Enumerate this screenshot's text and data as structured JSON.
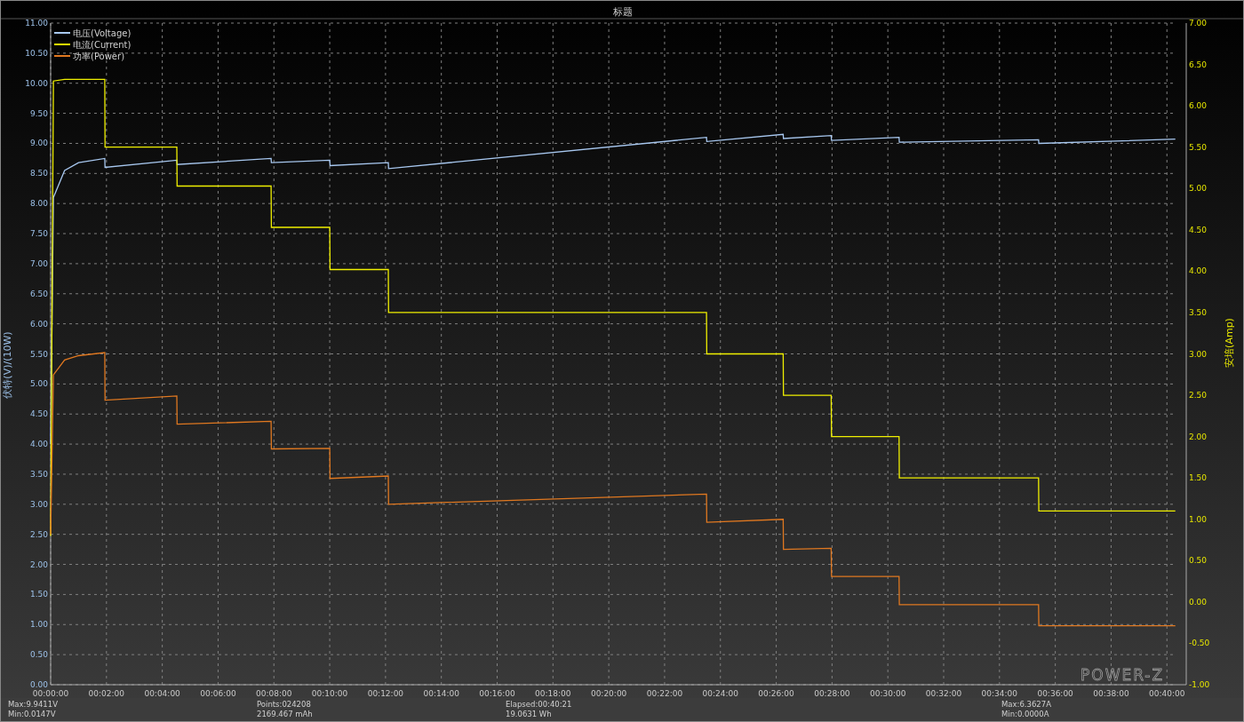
{
  "chart_data": {
    "type": "line",
    "title": "标题",
    "grid": true,
    "legend": "upper left",
    "ylabel": "伏特(V)/(10W)",
    "xlim": [
      0,
      40.31
    ],
    "ylim": [
      0,
      11
    ],
    "y2label": "安培(Amp)",
    "y2lim": [
      -1,
      7
    ],
    "x": [
      0,
      0.1,
      0.5,
      1,
      1.94,
      1.95,
      4.52,
      4.53,
      7.9,
      7.91,
      10.0,
      10.01,
      12.1,
      12.11,
      23.5,
      23.51,
      26.25,
      26.26,
      27.97,
      27.98,
      30.4,
      30.41,
      35.4,
      35.41,
      40.3
    ],
    "series": [
      {
        "name": "电压(Voltage)",
        "color": "#a8c8f0",
        "values": [
          4.0,
          8.1,
          8.55,
          8.68,
          8.75,
          8.6,
          8.72,
          8.65,
          8.75,
          8.68,
          8.72,
          8.63,
          8.68,
          8.58,
          9.1,
          9.03,
          9.15,
          9.08,
          9.13,
          9.05,
          9.1,
          9.02,
          9.06,
          9.0,
          9.07
        ]
      },
      {
        "name": "电流(Current)",
        "color": "#f0f000",
        "axis": "y2",
        "values": [
          0.8,
          6.3,
          6.32,
          6.32,
          6.32,
          5.5,
          5.5,
          5.03,
          5.03,
          4.53,
          4.53,
          4.02,
          4.02,
          3.5,
          3.5,
          3.0,
          3.0,
          2.5,
          2.5,
          2.0,
          2.0,
          1.5,
          1.5,
          1.1,
          1.1
        ]
      },
      {
        "name": "功率(Power)",
        "color": "#e07820",
        "values": [
          2.5,
          5.15,
          5.4,
          5.47,
          5.52,
          4.73,
          4.8,
          4.33,
          4.38,
          3.92,
          3.93,
          3.43,
          3.47,
          3.0,
          3.17,
          2.7,
          2.75,
          2.25,
          2.27,
          1.8,
          1.8,
          1.33,
          1.33,
          0.98,
          0.98
        ]
      }
    ],
    "xticks": [
      {
        "value": 0,
        "label": "00:00:00"
      },
      {
        "value": 2,
        "label": "00:02:00"
      },
      {
        "value": 4,
        "label": "00:04:00"
      },
      {
        "value": 6,
        "label": "00:06:00"
      },
      {
        "value": 8,
        "label": "00:08:00"
      },
      {
        "value": 10,
        "label": "00:10:00"
      },
      {
        "value": 12,
        "label": "00:12:00"
      },
      {
        "value": 14,
        "label": "00:14:00"
      },
      {
        "value": 16,
        "label": "00:16:00"
      },
      {
        "value": 18,
        "label": "00:18:00"
      },
      {
        "value": 20,
        "label": "00:20:00"
      },
      {
        "value": 22,
        "label": "00:22:00"
      },
      {
        "value": 24,
        "label": "00:24:00"
      },
      {
        "value": 26,
        "label": "00:26:00"
      },
      {
        "value": 28,
        "label": "00:28:00"
      },
      {
        "value": 30,
        "label": "00:30:00"
      },
      {
        "value": 32,
        "label": "00:32:00"
      },
      {
        "value": 34,
        "label": "00:34:00"
      },
      {
        "value": 36,
        "label": "00:36:00"
      },
      {
        "value": 38,
        "label": "00:38:00"
      },
      {
        "value": 40,
        "label": "00:40:00"
      }
    ],
    "yticks": [
      {
        "value": 0,
        "label": "0.00"
      },
      {
        "value": 0.5,
        "label": "0.50"
      },
      {
        "value": 1,
        "label": "1.00"
      },
      {
        "value": 1.5,
        "label": "1.50"
      },
      {
        "value": 2,
        "label": "2.00"
      },
      {
        "value": 2.5,
        "label": "2.50"
      },
      {
        "value": 3,
        "label": "3.00"
      },
      {
        "value": 3.5,
        "label": "3.50"
      },
      {
        "value": 4,
        "label": "4.00"
      },
      {
        "value": 4.5,
        "label": "4.50"
      },
      {
        "value": 5,
        "label": "5.00"
      },
      {
        "value": 5.5,
        "label": "5.50"
      },
      {
        "value": 6,
        "label": "6.00"
      },
      {
        "value": 6.5,
        "label": "6.50"
      },
      {
        "value": 7,
        "label": "7.00"
      },
      {
        "value": 7.5,
        "label": "7.50"
      },
      {
        "value": 8,
        "label": "8.00"
      },
      {
        "value": 8.5,
        "label": "8.50"
      },
      {
        "value": 9,
        "label": "9.00"
      },
      {
        "value": 9.5,
        "label": "9.50"
      },
      {
        "value": 10,
        "label": "10.00"
      },
      {
        "value": 10.5,
        "label": "10.50"
      },
      {
        "value": 11,
        "label": "11.00"
      }
    ],
    "y2ticks": [
      {
        "value": -1,
        "label": "-1.00"
      },
      {
        "value": -0.5,
        "label": "-0.50"
      },
      {
        "value": 0,
        "label": "0.00"
      },
      {
        "value": 0.5,
        "label": "0.50"
      },
      {
        "value": 1,
        "label": "1.00"
      },
      {
        "value": 1.5,
        "label": "1.50"
      },
      {
        "value": 2,
        "label": "2.00"
      },
      {
        "value": 2.5,
        "label": "2.50"
      },
      {
        "value": 3,
        "label": "3.00"
      },
      {
        "value": 3.5,
        "label": "3.50"
      },
      {
        "value": 4,
        "label": "4.00"
      },
      {
        "value": 4.5,
        "label": "4.50"
      },
      {
        "value": 5,
        "label": "5.00"
      },
      {
        "value": 5.5,
        "label": "5.50"
      },
      {
        "value": 6,
        "label": "6.00"
      },
      {
        "value": 6.5,
        "label": "6.50"
      },
      {
        "value": 7,
        "label": "7.00"
      }
    ]
  },
  "logo": "POWER-Z",
  "status_bar": [
    {
      "lines": [
        "Max:9.9411V",
        "Min:0.0147V"
      ]
    },
    {
      "lines": [
        "Points:024208",
        "2169.467 mAh"
      ]
    },
    {
      "lines": [
        "Elapsed:00:40:21",
        "19.0631 Wh"
      ]
    },
    {
      "lines": [
        "Max:6.3627A",
        "Min:0.0000A"
      ]
    }
  ]
}
